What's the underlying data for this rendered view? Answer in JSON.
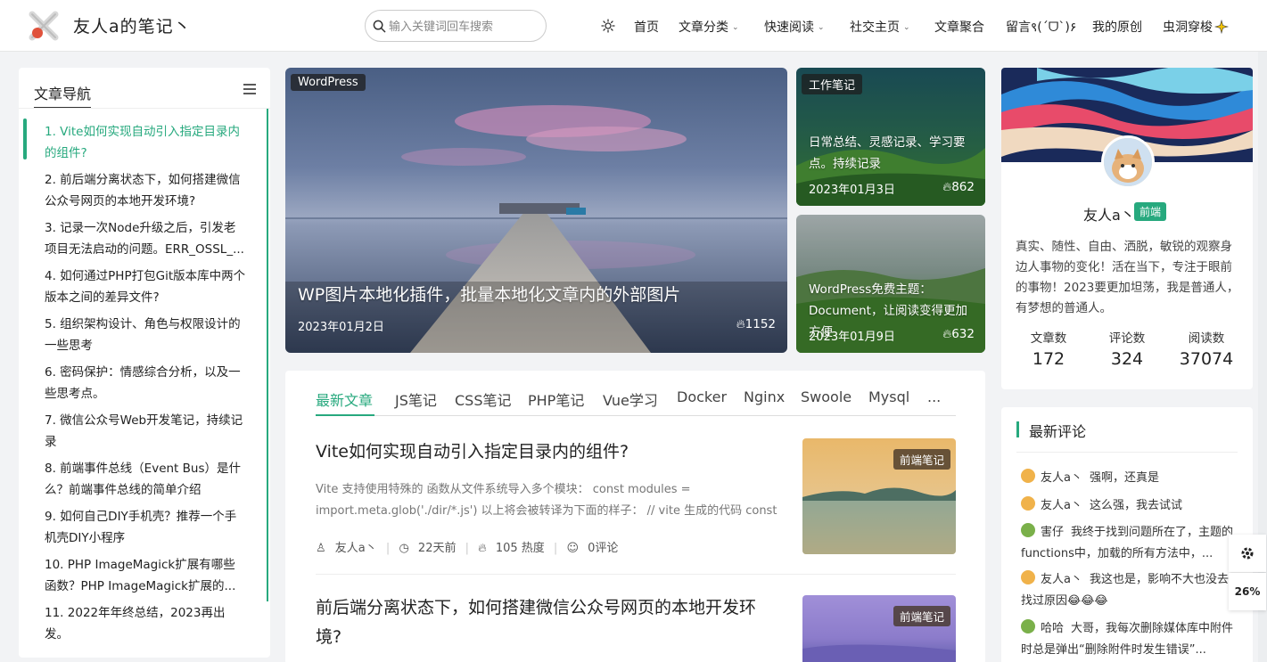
{
  "header": {
    "site_name": "友人a的笔记丶",
    "search_placeholder": "输入关键词回车搜索",
    "nav": [
      {
        "label": "首页",
        "caret": false
      },
      {
        "label": "文章分类",
        "caret": true
      },
      {
        "label": "快速阅读",
        "caret": true
      },
      {
        "label": "社交主页",
        "caret": true
      },
      {
        "label": "文章聚合",
        "caret": false
      },
      {
        "label": "留言९(ˊᗜˋ)۶",
        "caret": false
      },
      {
        "label": "我的原创",
        "caret": false
      },
      {
        "label": "虫洞穿梭",
        "caret": false
      }
    ]
  },
  "toc": {
    "title": "文章导航",
    "items": [
      "1. Vite如何实现自动引入指定目录内的组件?",
      "2. 前后端分离状态下，如何搭建微信公众号网页的本地开发环境?",
      "3. 记录一次Node升级之后，引发老项目无法启动的问题。ERR_OSSL_...",
      "4. 如何通过PHP打包Git版本库中两个版本之间的差异文件?",
      "5. 组织架构设计、角色与权限设计的一些思考",
      "6. 密码保护：情感综合分析，以及一些思考点。",
      "7. 微信公众号Web开发笔记，持续记录",
      "8. 前端事件总线（Event Bus）是什么？前端事件总线的简单介绍",
      "9. 如何自己DIY手机壳？推荐一个手机壳DIY小程序",
      "10. PHP ImageMagick扩展有哪些函数？PHP ImageMagick扩展的...",
      "11. 2022年年终总结，2023再出发。"
    ]
  },
  "featured": {
    "main": {
      "badge": "WordPress",
      "title": "WP图片本地化插件，批量本地化文章内的外部图片",
      "date": "2023年01月2日",
      "heat": "1152"
    },
    "side": [
      {
        "badge": "工作笔记",
        "title": "日常总结、灵感记录、学习要点。持续记录",
        "date": "2023年01月3日",
        "heat": "862"
      },
      {
        "badge": "",
        "title": "WordPress免费主题：Document，让阅读变得更加方便",
        "date": "2023年01月9日",
        "heat": "632"
      }
    ]
  },
  "articles": {
    "tabs": [
      "最新文章",
      "JS笔记",
      "CSS笔记",
      "PHP笔记",
      "Vue学习",
      "Docker",
      "Nginx",
      "Swoole",
      "Mysql",
      "..."
    ],
    "list": [
      {
        "title": "Vite如何实现自动引入指定目录内的组件?",
        "excerpt": "Vite 支持使用特殊的 函数从文件系统导入多个模块： const modules = import.meta.glob('./dir/*.js') 以上将会被转译为下面的样子： // vite 生成的代码 const mo...",
        "author": "友人a丶",
        "time": "22天前",
        "heat": "105 热度",
        "comments": "0评论",
        "category": "前端笔记"
      },
      {
        "title": "前后端分离状态下，如何搭建微信公众号网页的本地开发环境?",
        "category": "前端笔记"
      }
    ]
  },
  "profile": {
    "name": "友人a丶",
    "tag": "前端",
    "bio": "真实、随性、自由、洒脱，敏锐的观察身边人事物的变化！活在当下，专注于眼前的事物！2023要更加坦荡，我是普通人，有梦想的普通人。",
    "stats": [
      {
        "label": "文章数",
        "value": "172"
      },
      {
        "label": "评论数",
        "value": "324"
      },
      {
        "label": "阅读数",
        "value": "37074"
      }
    ]
  },
  "comments": {
    "title": "最新评论",
    "items": [
      {
        "who": "友人a丶",
        "text": "强啊，还真是"
      },
      {
        "who": "友人a丶",
        "text": "这么强，我去试试"
      },
      {
        "who": "害仔",
        "text": "我终于找到问题所在了，主题的functions中，加载的所有方法中，..."
      },
      {
        "who": "友人a丶",
        "text": "我这也是，影响不大也没去找过原因😂😂😂"
      },
      {
        "who": "哈哈",
        "text": "大哥，我每次删除媒体库中附件时总是弹出“删除附件时发生错误”..."
      }
    ]
  },
  "widgets": {
    "progress": "26%"
  }
}
